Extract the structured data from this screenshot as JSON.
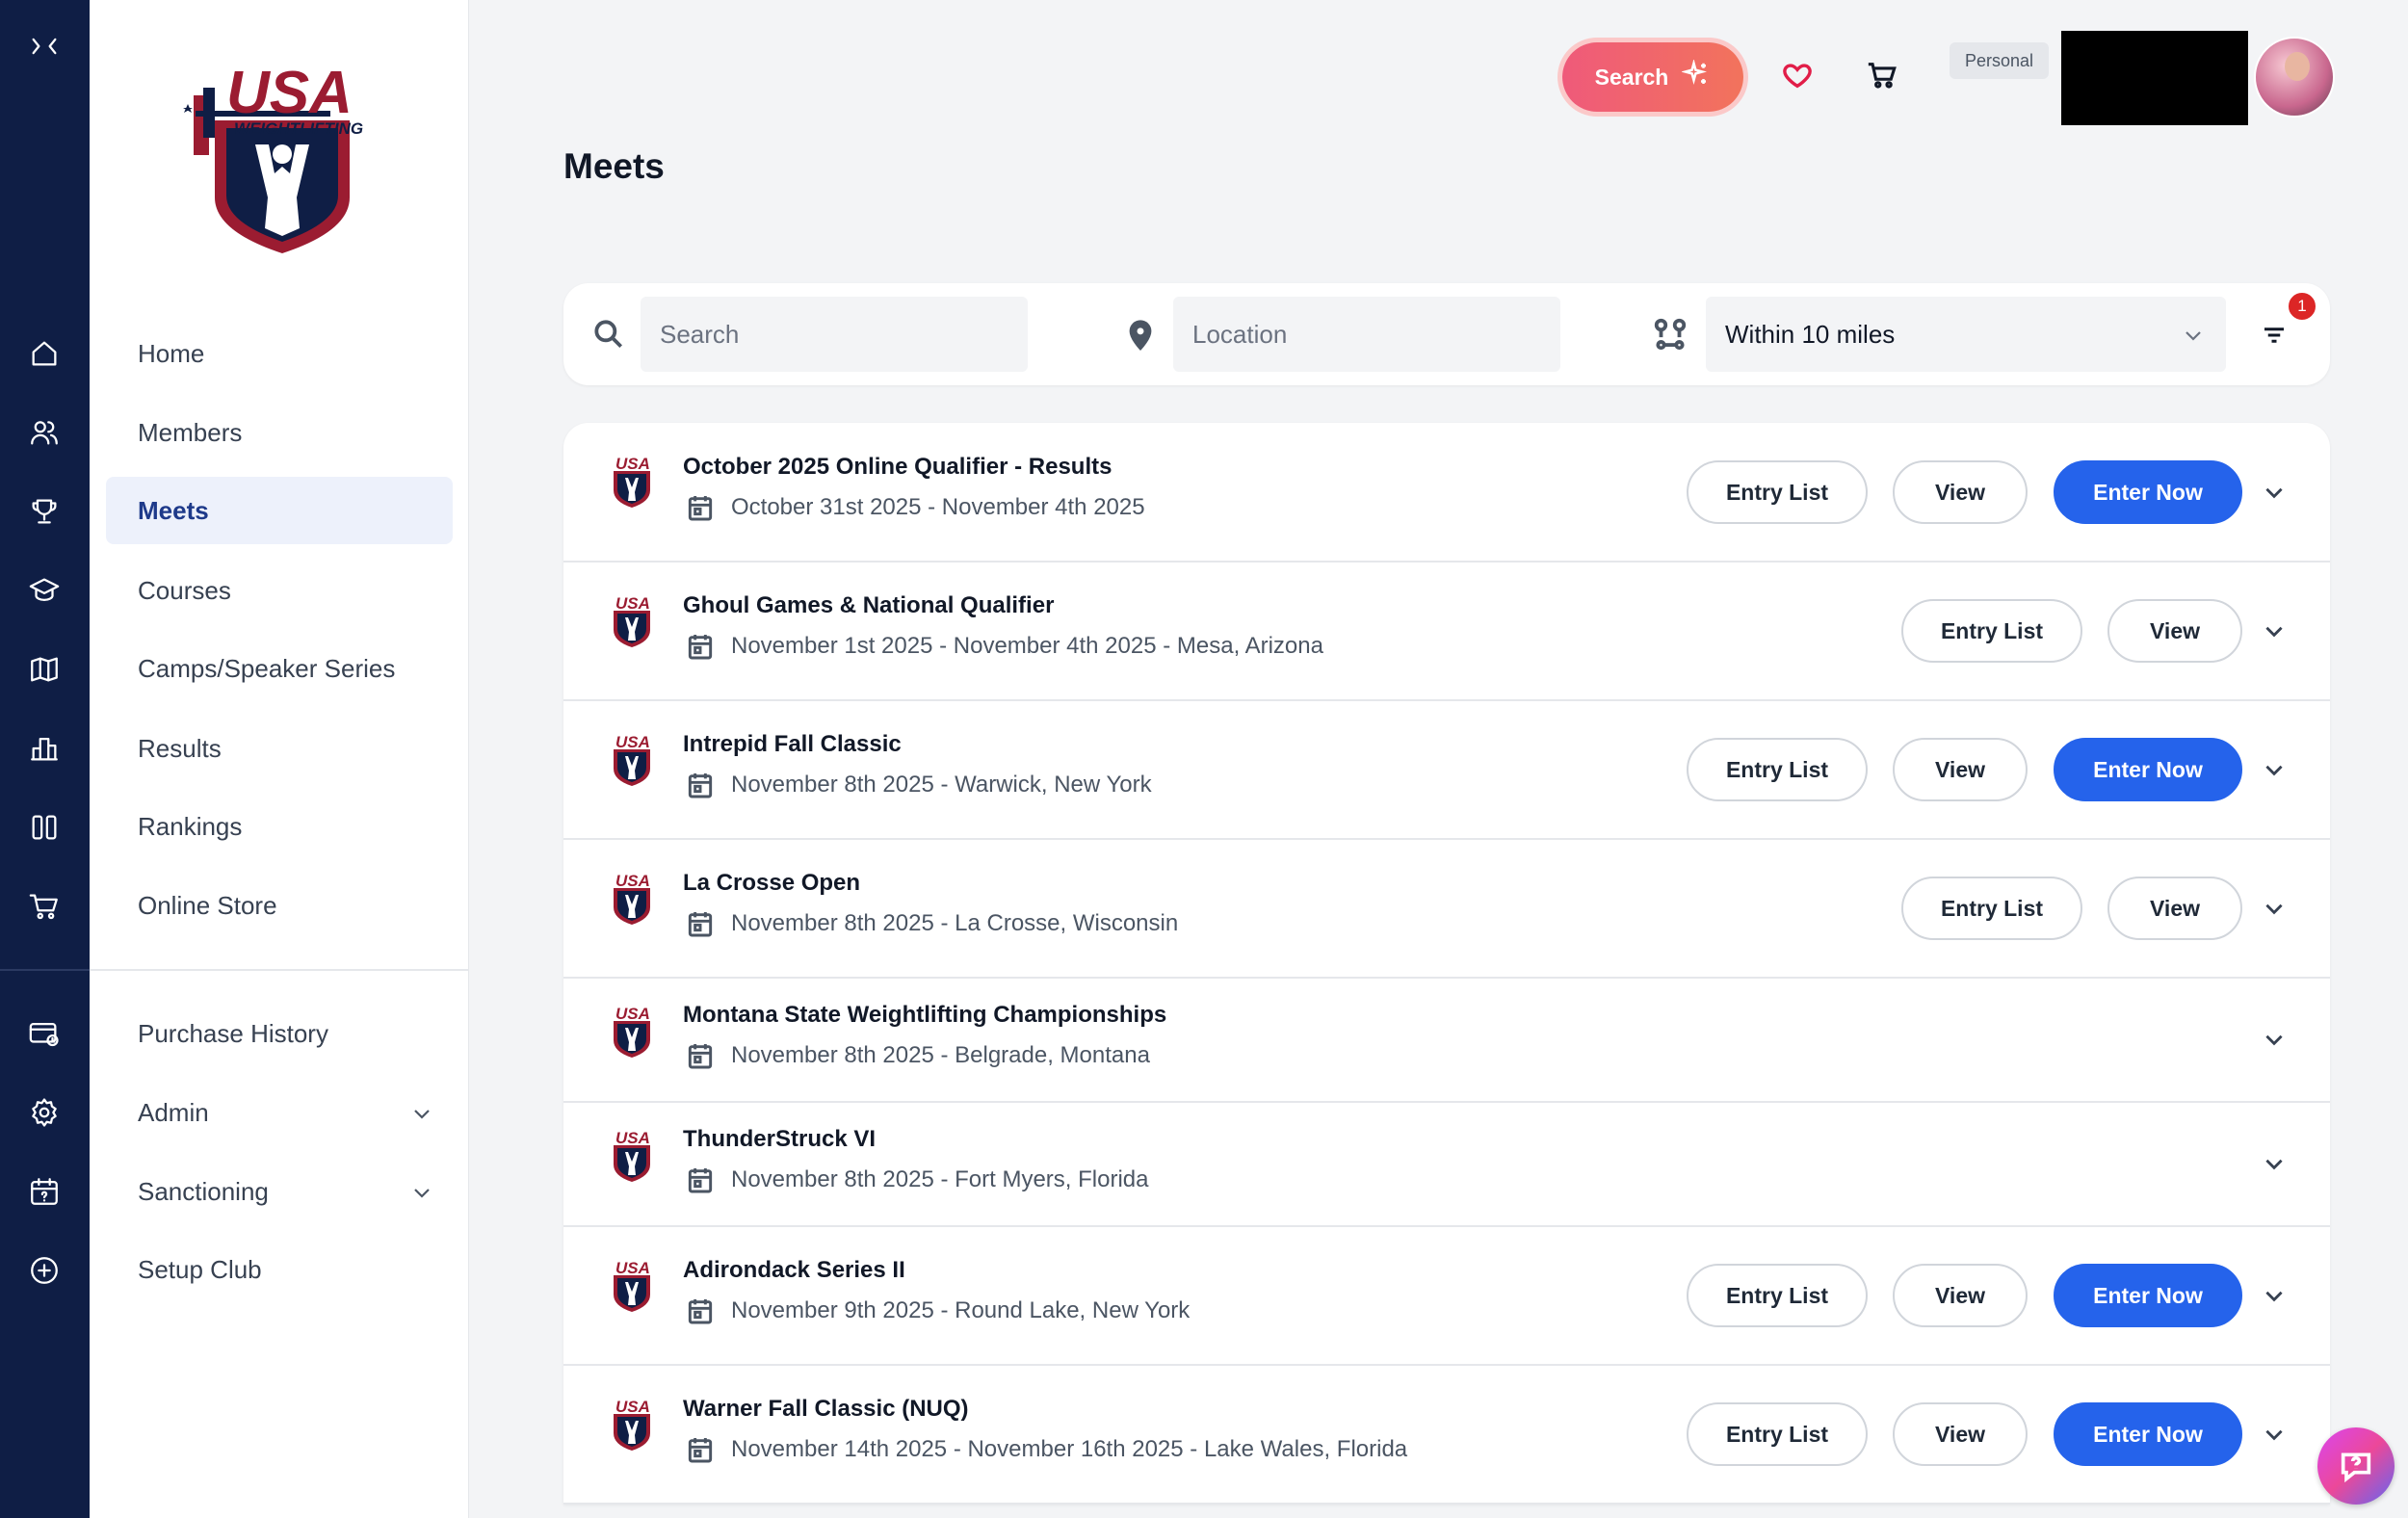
{
  "brand": {
    "logo_top": "USA",
    "logo_bottom": "WEIGHTLIFTING"
  },
  "rail_icons": [
    "collapse-icon",
    "home-icon",
    "members-icon",
    "trophy-icon",
    "graduation-cap-icon",
    "map-icon",
    "bar-chart-icon",
    "columns-icon",
    "cart-icon",
    "card-clock-icon",
    "gear-icon",
    "calendar-question-icon",
    "plus-circle-icon"
  ],
  "sidebar": {
    "items": [
      {
        "label": "Home"
      },
      {
        "label": "Members"
      },
      {
        "label": "Meets"
      },
      {
        "label": "Courses"
      },
      {
        "label": "Camps/Speaker Series"
      },
      {
        "label": "Results"
      },
      {
        "label": "Rankings"
      },
      {
        "label": "Online Store"
      }
    ],
    "secondary": [
      {
        "label": "Purchase History"
      },
      {
        "label": "Admin"
      },
      {
        "label": "Sanctioning"
      },
      {
        "label": "Setup Club"
      }
    ],
    "active": "Meets"
  },
  "header": {
    "search_label": "Search",
    "personal_badge": "Personal"
  },
  "page": {
    "title": "Meets"
  },
  "filters": {
    "search_placeholder": "Search",
    "location_placeholder": "Location",
    "distance": "Within 10 miles",
    "filter_count": "1"
  },
  "actions": {
    "entry_list": "Entry List",
    "view": "View",
    "enter_now": "Enter Now"
  },
  "meets": [
    {
      "name": "October 2025 Online Qualifier - Results",
      "info": "October 31st 2025 - November 4th 2025"
    },
    {
      "name": "Ghoul Games & National Qualifier",
      "info": "November 1st 2025 - November 4th 2025 - Mesa, Arizona"
    },
    {
      "name": "Intrepid Fall Classic",
      "info": "November 8th 2025 - Warwick, New York"
    },
    {
      "name": "La Crosse Open",
      "info": "November 8th 2025 - La Crosse, Wisconsin"
    },
    {
      "name": "Montana State Weightlifting Championships",
      "info": "November 8th 2025 - Belgrade, Montana"
    },
    {
      "name": "ThunderStruck VI",
      "info": "November 8th 2025 - Fort Myers, Florida"
    },
    {
      "name": "Adirondack Series II",
      "info": "November 9th 2025 - Round Lake, New York"
    },
    {
      "name": "Warner Fall Classic (NUQ)",
      "info": "November 14th 2025 - November 16th 2025 - Lake Wales, Florida"
    }
  ],
  "colors": {
    "rail": "#0f1e45",
    "primary": "#2563eb",
    "accent": "#ef5a7a",
    "brand_red": "#9b1c31",
    "brand_navy": "#0f1e45"
  }
}
